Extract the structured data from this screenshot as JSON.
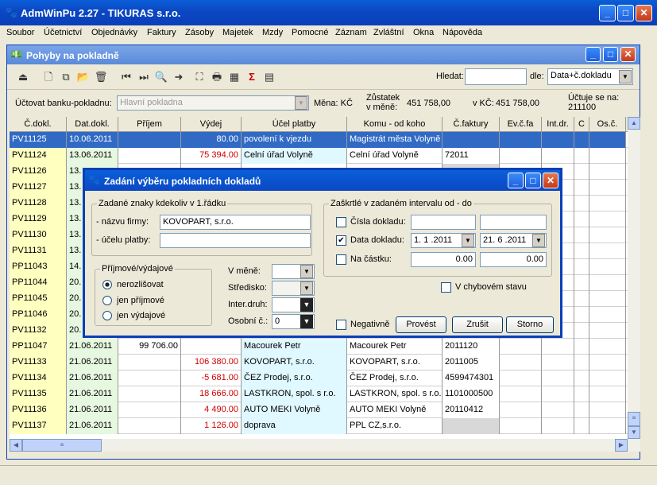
{
  "app": {
    "title": "AdmWinPu 2.27 - TIKURAS s.r.o."
  },
  "menu": [
    "Soubor",
    "Účetnictví",
    "Objednávky",
    "Faktury",
    "Zásoby",
    "Majetek",
    "Mzdy",
    "Pomocné",
    "Záznam",
    "Zvláštní",
    "Okna",
    "Nápověda"
  ],
  "child": {
    "title": "Pohyby na pokladně"
  },
  "search": {
    "label": "Hledat:",
    "value": "",
    "by_label": "dle:",
    "by_value": "Data+č.dokladu"
  },
  "info": {
    "account_label": "Účtovat banku-pokladnu:",
    "account_value": "Hlavní pokladna",
    "currency_label": "Měna: KČ",
    "balance_label_1": "Zůstatek",
    "balance_label_2": "v měně:",
    "balance_value": "451 758,00",
    "kc_label": "v KČ:",
    "kc_value": "451 758,00",
    "since_label": "Účtuje se na:",
    "since_value": "211100"
  },
  "grid": {
    "columns": [
      "Č.dokl.",
      "Dat.dokl.",
      "Příjem",
      "Výdej",
      "Účel platby",
      "Komu - od koho",
      "Č.faktury",
      "Ev.č.fa",
      "Int.dr.",
      "C",
      "Os.č."
    ],
    "rows": [
      {
        "doc": "PV11125",
        "date": "10.06.2011",
        "income": "",
        "expense": "80.00",
        "purpose": "povolení k vjezdu",
        "who": "Magistrát města Volyně",
        "inv": "",
        "selected": true
      },
      {
        "doc": "PV11124",
        "date": "13.06.2011",
        "income": "",
        "expense": "75 394.00",
        "purpose": "Celní úřad Volyně",
        "who": "Celní úřad Volyně",
        "inv": "72011"
      },
      {
        "doc": "PV11126",
        "date": "13.",
        "income": "",
        "expense": "",
        "purpose": "",
        "who": "",
        "inv": ""
      },
      {
        "doc": "PV11127",
        "date": "13.",
        "income": "",
        "expense": "",
        "purpose": "",
        "who": "",
        "inv": ""
      },
      {
        "doc": "PV11128",
        "date": "13.",
        "income": "",
        "expense": "",
        "purpose": "",
        "who": "",
        "inv": ""
      },
      {
        "doc": "PV11129",
        "date": "13.",
        "income": "",
        "expense": "",
        "purpose": "",
        "who": "",
        "inv": ""
      },
      {
        "doc": "PV11130",
        "date": "13.",
        "income": "",
        "expense": "",
        "purpose": "",
        "who": "",
        "inv": ""
      },
      {
        "doc": "PV11131",
        "date": "13.",
        "income": "",
        "expense": "",
        "purpose": "",
        "who": "",
        "inv": ""
      },
      {
        "doc": "PP11043",
        "date": "14.",
        "income": "",
        "expense": "",
        "purpose": "",
        "who": "",
        "inv": ""
      },
      {
        "doc": "PP11044",
        "date": "20.",
        "income": "",
        "expense": "",
        "purpose": "",
        "who": "",
        "inv": ""
      },
      {
        "doc": "PP11045",
        "date": "20.",
        "income": "",
        "expense": "",
        "purpose": "",
        "who": "",
        "inv": ""
      },
      {
        "doc": "PP11046",
        "date": "20.",
        "income": "",
        "expense": "",
        "purpose": "",
        "who": "",
        "inv": ""
      },
      {
        "doc": "PV11132",
        "date": "20.",
        "income": "",
        "expense": "",
        "purpose": "",
        "who": "",
        "inv": ""
      },
      {
        "doc": "PP11047",
        "date": "21.06.2011",
        "income": "99 706.00",
        "expense": "",
        "purpose": "Macourek Petr",
        "who": "Macourek Petr",
        "inv": "2011120"
      },
      {
        "doc": "PV11133",
        "date": "21.06.2011",
        "income": "",
        "expense": "106 380.00",
        "purpose": "KOVOPART, s.r.o.",
        "who": "KOVOPART, s.r.o.",
        "inv": "2011005"
      },
      {
        "doc": "PV11134",
        "date": "21.06.2011",
        "income": "",
        "expense": "-5 681.00",
        "purpose": "ČEZ Prodej, s.r.o.",
        "who": "ČEZ Prodej, s.r.o.",
        "inv": "4599474301"
      },
      {
        "doc": "PV11135",
        "date": "21.06.2011",
        "income": "",
        "expense": "18 666.00",
        "purpose": "LASTKRON, spol. s r.o.",
        "who": "LASTKRON, spol. s r.o.",
        "inv": "1101000500"
      },
      {
        "doc": "PV11136",
        "date": "21.06.2011",
        "income": "",
        "expense": "4 490.00",
        "purpose": "AUTO MEKI Volyně",
        "who": "AUTO MEKI Volyně",
        "inv": "20110412"
      },
      {
        "doc": "PV11137",
        "date": "21.06.2011",
        "income": "",
        "expense": "1 126.00",
        "purpose": "doprava",
        "who": "PPL CZ,s.r.o.",
        "inv": ""
      }
    ]
  },
  "dialog": {
    "title": "Zadání výběru pokladních dokladů",
    "left_group": "Zadané znaky kdekoliv v 1.řádku",
    "firm_label": "- názvu firmy:",
    "firm_value": "KOVOPART, s.r.o.",
    "purpose_label": "- účelu platby:",
    "purpose_value": "",
    "type_group": "Příjmové/výdajové",
    "radio1": "nerozlišovat",
    "radio2": "jen příjmové",
    "radio3": "jen výdajové",
    "currency_label": "V měně:",
    "center_label": "Středisko:",
    "inter_label": "Inter.druh:",
    "person_label": "Osobní č.:",
    "person_value": "0",
    "right_group": "Zaškrtlé v zadaném intervalu od - do",
    "num_label": "Čísla dokladu:",
    "date_label": "Data dokladu:",
    "date_from": "1. 1 .2011",
    "date_to": "21. 6 .2011",
    "amount_label": "Na částku:",
    "amount_from": "0.00",
    "amount_to": "0.00",
    "error_label": "V chybovém stavu",
    "negative_label": "Negativně",
    "btn_run": "Provést",
    "btn_cancel": "Zrušit",
    "btn_storno": "Storno"
  }
}
